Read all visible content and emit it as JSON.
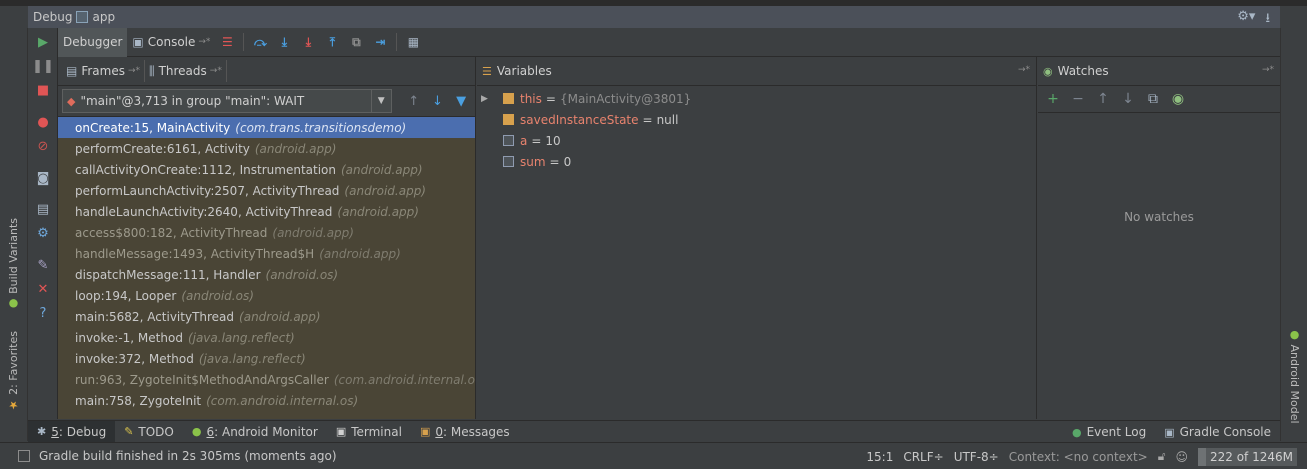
{
  "window": {
    "title_prefix": "Debug",
    "title_app": "app"
  },
  "left_strip": {
    "build_variants": "Build Variants",
    "favorites": "2: Favorites"
  },
  "right_strip": {
    "android_model": "Android Model"
  },
  "toolbar": {
    "debugger_tab": "Debugger",
    "console_tab": "Console"
  },
  "frames_panel": {
    "frames_tab": "Frames",
    "threads_tab": "Threads",
    "thread_selector": "\"main\"@3,713 in group \"main\": WAIT",
    "frames": [
      {
        "method": "onCreate:15, MainActivity",
        "package": "(com.trans.transitionsdemo)"
      },
      {
        "method": "performCreate:6161, Activity",
        "package": "(android.app)"
      },
      {
        "method": "callActivityOnCreate:1112, Instrumentation",
        "package": "(android.app)"
      },
      {
        "method": "performLaunchActivity:2507, ActivityThread",
        "package": "(android.app)"
      },
      {
        "method": "handleLaunchActivity:2640, ActivityThread",
        "package": "(android.app)"
      },
      {
        "method": "access$800:182, ActivityThread",
        "package": "(android.app)"
      },
      {
        "method": "handleMessage:1493, ActivityThread$H",
        "package": "(android.app)"
      },
      {
        "method": "dispatchMessage:111, Handler",
        "package": "(android.os)"
      },
      {
        "method": "loop:194, Looper",
        "package": "(android.os)"
      },
      {
        "method": "main:5682, ActivityThread",
        "package": "(android.app)"
      },
      {
        "method": "invoke:-1, Method",
        "package": "(java.lang.reflect)"
      },
      {
        "method": "invoke:372, Method",
        "package": "(java.lang.reflect)"
      },
      {
        "method": "run:963, ZygoteInit$MethodAndArgsCaller",
        "package": "(com.android.internal.os)"
      },
      {
        "method": "main:758, ZygoteInit",
        "package": "(com.android.internal.os)"
      }
    ]
  },
  "variables_panel": {
    "title": "Variables",
    "items": [
      {
        "name": "this",
        "op": "=",
        "value": "{MainActivity@3801}"
      },
      {
        "name": "savedInstanceState",
        "op": "=",
        "value": "null"
      },
      {
        "name": "a",
        "op": "=",
        "value": "10"
      },
      {
        "name": "sum",
        "op": "=",
        "value": "0"
      }
    ]
  },
  "watches_panel": {
    "title": "Watches",
    "empty_text": "No watches"
  },
  "bottom_tabs": {
    "debug_num": "5",
    "debug": ": Debug",
    "todo": "TODO",
    "android_monitor_num": "6",
    "android_monitor": ": Android Monitor",
    "terminal": "Terminal",
    "messages_num": "0",
    "messages": ": Messages",
    "event_log": "Event Log",
    "gradle_console": "Gradle Console"
  },
  "status_bar": {
    "message": "Gradle build finished in 2s 305ms (moments ago)",
    "position": "15:1",
    "line_sep": "CRLF÷",
    "encoding": "UTF-8÷",
    "context": "Context: <no context>",
    "memory": "222 of 1246M"
  },
  "colors": {
    "accent": "#4b6eaf",
    "frames_bg": "#4a4536",
    "var_name": "#e8836e",
    "bg": "#3c3f41"
  }
}
